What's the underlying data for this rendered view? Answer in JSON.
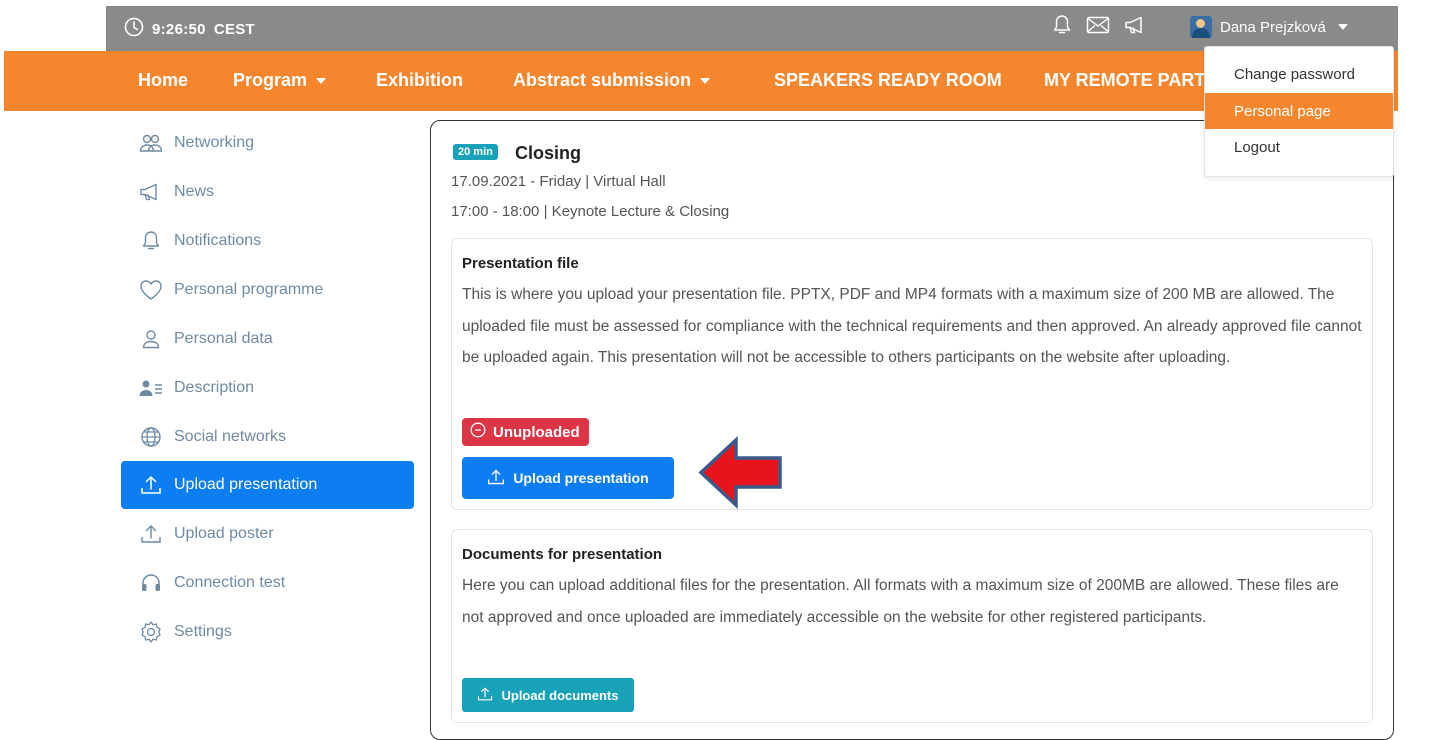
{
  "topbar": {
    "time": "9:26:50",
    "timezone": "CEST",
    "icons": [
      "bell-icon",
      "envelope-icon",
      "megaphone-icon"
    ],
    "user_name": "Dana Prejzková"
  },
  "nav": {
    "items": [
      {
        "label": "Home"
      },
      {
        "label": "Program",
        "dropdown": true
      },
      {
        "label": "Exhibition"
      },
      {
        "label": "Abstract submission",
        "dropdown": true
      },
      {
        "label": "SPEAKERS READY ROOM"
      },
      {
        "label": "MY REMOTE PART"
      }
    ]
  },
  "user_menu": {
    "items": [
      {
        "label": "Change password",
        "active": false
      },
      {
        "label": "Personal page",
        "active": true
      },
      {
        "label": "Logout",
        "active": false
      }
    ]
  },
  "sidebar": {
    "items": [
      {
        "label": "Networking",
        "icon": "people-icon"
      },
      {
        "label": "News",
        "icon": "megaphone-icon"
      },
      {
        "label": "Notifications",
        "icon": "bell-icon"
      },
      {
        "label": "Personal programme",
        "icon": "heart-icon"
      },
      {
        "label": "Personal data",
        "icon": "person-icon"
      },
      {
        "label": "Description",
        "icon": "person-list-icon"
      },
      {
        "label": "Social networks",
        "icon": "globe-icon"
      },
      {
        "label": "Upload presentation",
        "icon": "upload-icon",
        "active": true
      },
      {
        "label": "Upload poster",
        "icon": "upload-icon"
      },
      {
        "label": "Connection test",
        "icon": "headphones-icon"
      },
      {
        "label": "Settings",
        "icon": "gear-icon"
      }
    ]
  },
  "session": {
    "duration": "20 min",
    "title": "Closing",
    "date_line": "17.09.2021 - Friday | Virtual Hall",
    "time_line": "17:00 - 18:00 | Keynote Lecture & Closing"
  },
  "presentation_file": {
    "heading": "Presentation file",
    "description": "This is where you upload your presentation file. PPTX, PDF and MP4 formats with a maximum size of 200 MB are allowed. The uploaded file must be assessed for compliance with the technical requirements and then approved. An already approved file cannot be uploaded again. This presentation will not be accessible to others participants on the website after uploading.",
    "status": "Unuploaded",
    "button": "Upload presentation"
  },
  "documents": {
    "heading": "Documents for presentation",
    "description": "Here you can upload additional files for the presentation. All formats with a maximum size of 200MB are allowed. These files are not approved and once uploaded are immediately accessible on the website for other registered participants.",
    "button": "Upload documents"
  },
  "colors": {
    "nav_orange": "#f5862e",
    "topbar_gray": "#8a8a8a",
    "primary_blue": "#0d7ef2",
    "teal": "#17a2b8",
    "danger_red": "#dc3545",
    "sidebar_text": "#6f8aa3",
    "arrow_red": "#e8141b"
  }
}
